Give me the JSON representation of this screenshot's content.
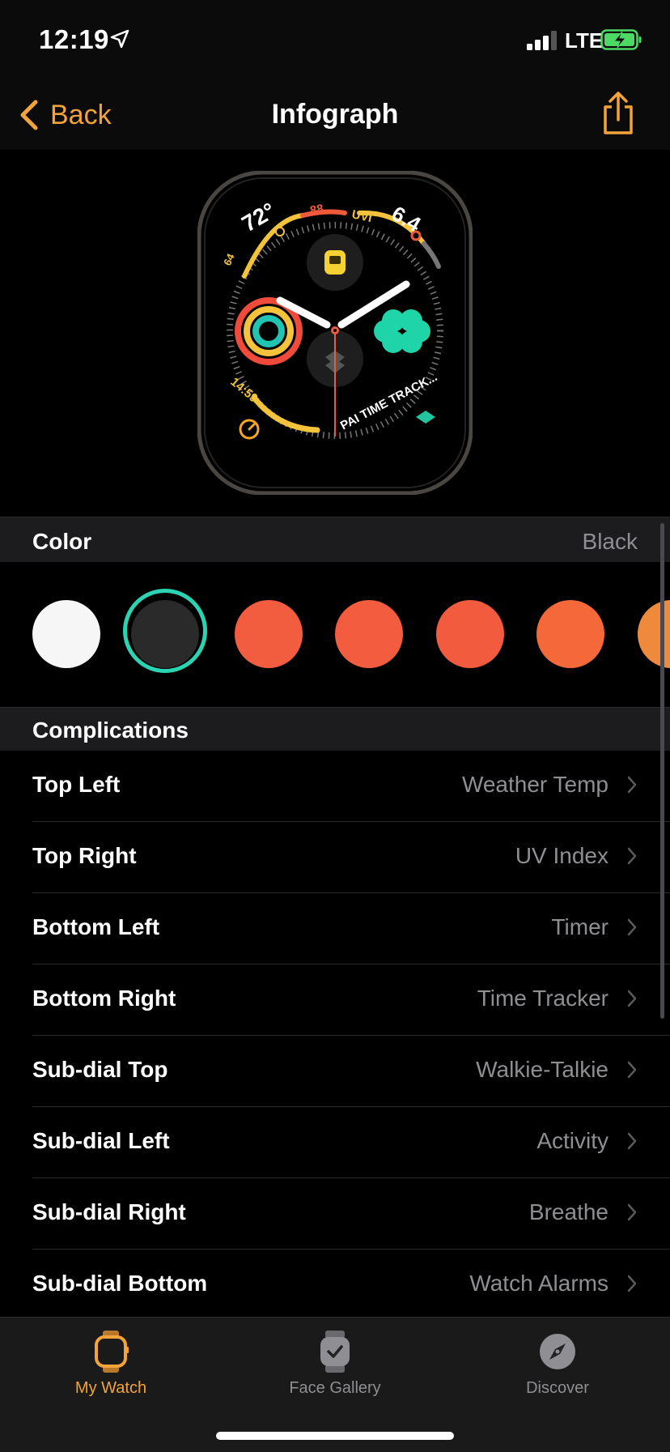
{
  "status": {
    "time": "12:19",
    "network": "LTE"
  },
  "nav": {
    "back_label": "Back",
    "title": "Infograph"
  },
  "watch_face": {
    "top_left_temp": "72°",
    "top_left_high": "88",
    "top_left_low": "64",
    "uv_label": "UVI",
    "uv_value": "6.4",
    "timer_value": "14:59",
    "time_tracker_label": "PAI TIME TRACK..."
  },
  "color_section": {
    "title": "Color",
    "selected": "Black",
    "swatches": [
      "#f6f6f6",
      "#2a2a2a",
      "#f25c3f",
      "#f35c3e",
      "#f25b3e",
      "#f5683a",
      "#ef8a3c"
    ]
  },
  "complications_section": {
    "title": "Complications"
  },
  "complications": [
    {
      "label": "Top Left",
      "value": "Weather Temp"
    },
    {
      "label": "Top Right",
      "value": "UV Index"
    },
    {
      "label": "Bottom Left",
      "value": "Timer"
    },
    {
      "label": "Bottom Right",
      "value": "Time Tracker"
    },
    {
      "label": "Sub-dial Top",
      "value": "Walkie-Talkie"
    },
    {
      "label": "Sub-dial Left",
      "value": "Activity"
    },
    {
      "label": "Sub-dial Right",
      "value": "Breathe"
    },
    {
      "label": "Sub-dial Bottom",
      "value": "Watch Alarms"
    }
  ],
  "tabs": [
    {
      "label": "My Watch",
      "icon": "watch-icon",
      "active": true
    },
    {
      "label": "Face Gallery",
      "icon": "face-gallery-icon",
      "active": false
    },
    {
      "label": "Discover",
      "icon": "compass-icon",
      "active": false
    }
  ],
  "colors": {
    "accent": "#f2a33a",
    "selection_ring": "#2bd3b2",
    "secondary_text": "#8e8e93"
  }
}
